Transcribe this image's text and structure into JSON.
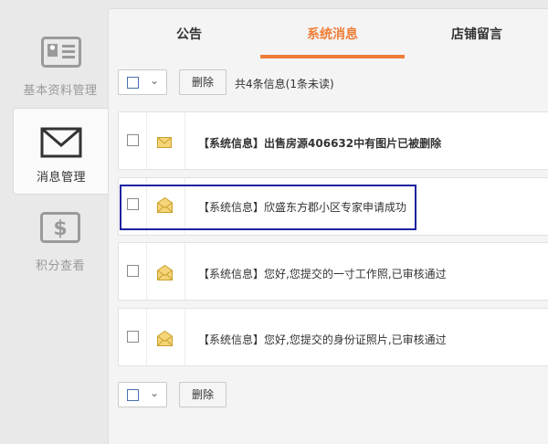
{
  "sidebar": {
    "items": [
      {
        "label": "基本资料管理",
        "icon": "id-card-icon"
      },
      {
        "label": "消息管理",
        "icon": "envelope-icon"
      },
      {
        "label": "积分查看",
        "icon": "dollar-icon"
      }
    ]
  },
  "tabs": [
    {
      "label": "公告"
    },
    {
      "label": "系统消息"
    },
    {
      "label": "店铺留言"
    }
  ],
  "toolbar": {
    "delete_label": "删除",
    "count_text": "共4条信息(1条未读)"
  },
  "messages": [
    {
      "tag": "【系统信息】",
      "text": "出售房源406632中有图片已被删除",
      "unread": true
    },
    {
      "tag": "【系统信息】",
      "text": "欣盛东方郡小区专家申请成功",
      "unread": false
    },
    {
      "tag": "【系统信息】",
      "text": "您好,您提交的一寸工作照,已审核通过",
      "unread": false
    },
    {
      "tag": "【系统信息】",
      "text": "您好,您提交的身份证照片,已审核通过",
      "unread": false
    }
  ],
  "bottom_toolbar": {
    "delete_label": "删除"
  },
  "colors": {
    "accent": "#ee7d36",
    "highlight": "#1c22a0"
  }
}
